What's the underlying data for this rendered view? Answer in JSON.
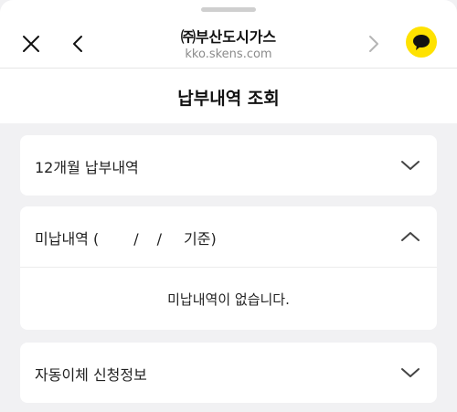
{
  "browser": {
    "site_title": "㈜부산도시가스",
    "site_url": "kko.skens.com"
  },
  "page": {
    "title": "납부내역 조회"
  },
  "sections": {
    "history": {
      "label": "12개월 납부내역",
      "expanded": false
    },
    "unpaid": {
      "label_prefix": "미납내역 (",
      "date_sep1": "/",
      "date_sep2": "/",
      "label_suffix": "기준)",
      "expanded": true,
      "empty_message": "미납내역이 없습니다."
    },
    "autopay": {
      "label": "자동이체 신청정보",
      "expanded": false
    }
  },
  "colors": {
    "kakao_yellow": "#ffe200",
    "background": "#f1f1f3"
  },
  "icons": {
    "close": "close-icon",
    "back": "chevron-left-icon",
    "forward": "chevron-right-icon",
    "chat": "kakaotalk-icon",
    "collapse": "chevron-up-icon",
    "expand": "chevron-down-icon"
  }
}
